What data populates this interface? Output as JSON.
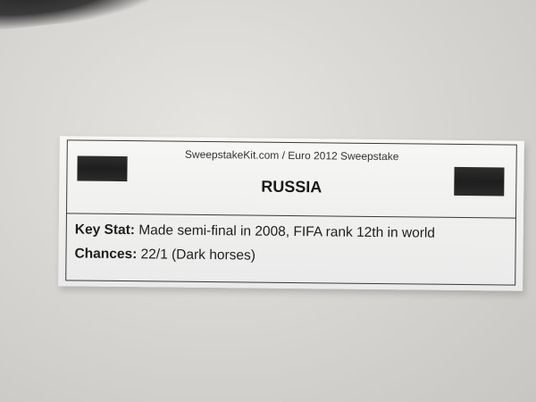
{
  "ticket": {
    "header": "SweepstakeKit.com / Euro 2012 Sweepstake",
    "team": "RUSSIA",
    "key_stat_label": "Key Stat:",
    "key_stat_value": " Made semi-final in 2008, FIFA rank 12th in world",
    "chances_label": "Chances:",
    "chances_value": " 22/1 (Dark horses)"
  },
  "colors": {
    "flag_print": "#222222",
    "paper": "#f3f3f1",
    "background": "#dcdad7"
  }
}
